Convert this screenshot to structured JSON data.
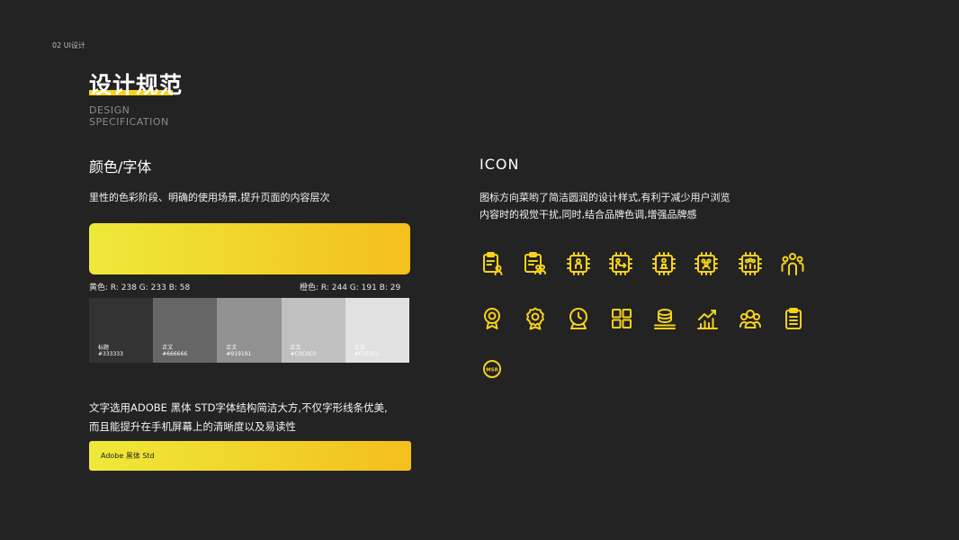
{
  "header": {
    "page_no": "02 UI设计"
  },
  "title": {
    "cn": "设计规范",
    "en_line1": "DESIGN",
    "en_line2": "SPECIFICATION"
  },
  "color_section": {
    "heading": "颜色/字体",
    "desc": "里性的色彩阶段、明确的使用场景,提升页面的内容层次",
    "gradient_start": "#EEE93A",
    "gradient_end": "#F4BF1D",
    "yellow_label": "黄色:  R:  238  G:  233  B:  58",
    "orange_label": "橙色:  R:  244  G:  191  B:  29",
    "swatches": [
      {
        "name": "标题",
        "hex": "#333333",
        "color": "#333333",
        "text_color": "#ffffff"
      },
      {
        "name": "正文",
        "hex": "#666666",
        "color": "#666666",
        "text_color": "#ffffff"
      },
      {
        "name": "正文",
        "hex": "#919191",
        "color": "#919191",
        "text_color": "#ffffff"
      },
      {
        "name": "正文",
        "hex": "#C0C0C0",
        "color": "#C0C0C0",
        "text_color": "#ffffff"
      },
      {
        "name": "正文",
        "hex": "#E1E1E1",
        "color": "#E1E1E1",
        "text_color": "#ffffff"
      }
    ],
    "font_desc_1": "文字选用ADOBE 黑体 STD字体结构简洁大方,不仅字形线条优美,",
    "font_desc_2": "而且能提升在手机屏幕上的清晰度以及易读性",
    "font_sample": "Adobe 黑体 Std"
  },
  "icon_section": {
    "heading": "ICON",
    "desc_1": "图标方向菜哟了简洁圆润的设计样式,有利于减少用户浏览",
    "desc_2": "内容时的视觉干扰,同时,结合品牌色调,增强品牌感",
    "accent": "#F7D21B",
    "icon_badge_text": "MSR",
    "icons_row1": [
      "clipboard-user-icon",
      "clipboard-team-icon",
      "chip-user-icon",
      "chip-transfer-icon",
      "chip-person-icon",
      "chip-group-icon",
      "chip-team-icon",
      "people-group-icon"
    ],
    "icons_row2": [
      "medal-icon",
      "award-ribbon-icon",
      "award-clock-icon",
      "grid-apps-icon",
      "coin-stack-icon",
      "bar-chart-icon",
      "user-group-icon",
      "notepad-icon"
    ],
    "icons_row3": [
      "msr-badge-icon"
    ]
  }
}
